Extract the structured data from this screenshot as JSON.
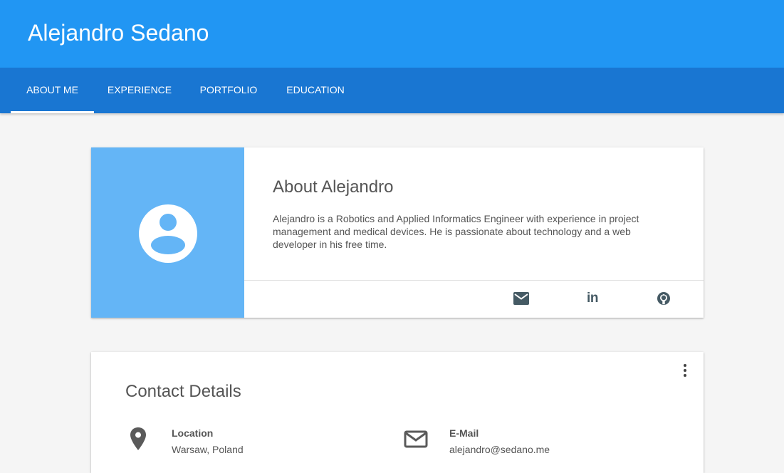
{
  "header": {
    "title": "Alejandro Sedano"
  },
  "tabs": [
    {
      "label": "ABOUT ME",
      "active": true
    },
    {
      "label": "EXPERIENCE",
      "active": false
    },
    {
      "label": "PORTFOLIO",
      "active": false
    },
    {
      "label": "EDUCATION",
      "active": false
    }
  ],
  "about": {
    "title": "About Alejandro",
    "text": "Alejandro is a Robotics and Applied Informatics Engineer with experience in project management and medical devices. He is passionate about technology and a web developer in his free time.",
    "avatar_icon": "account-circle-icon",
    "social": [
      {
        "icon": "mail-icon"
      },
      {
        "icon": "linkedin-icon",
        "text": "in"
      },
      {
        "icon": "github-icon"
      }
    ]
  },
  "contact": {
    "title": "Contact Details",
    "menu_icon": "more-vert-icon",
    "items": [
      {
        "icon": "location-pin-icon",
        "label": "Location",
        "value": "Warsaw, Poland"
      },
      {
        "icon": "email-icon",
        "label": "E-Mail",
        "value": "alejandro@sedano.me"
      }
    ]
  },
  "colors": {
    "primary": "#2196f3",
    "primary_dark": "#1976d2",
    "avatar_panel": "#64b5f6",
    "background": "#f5f5f5",
    "icon": "#455a64"
  }
}
